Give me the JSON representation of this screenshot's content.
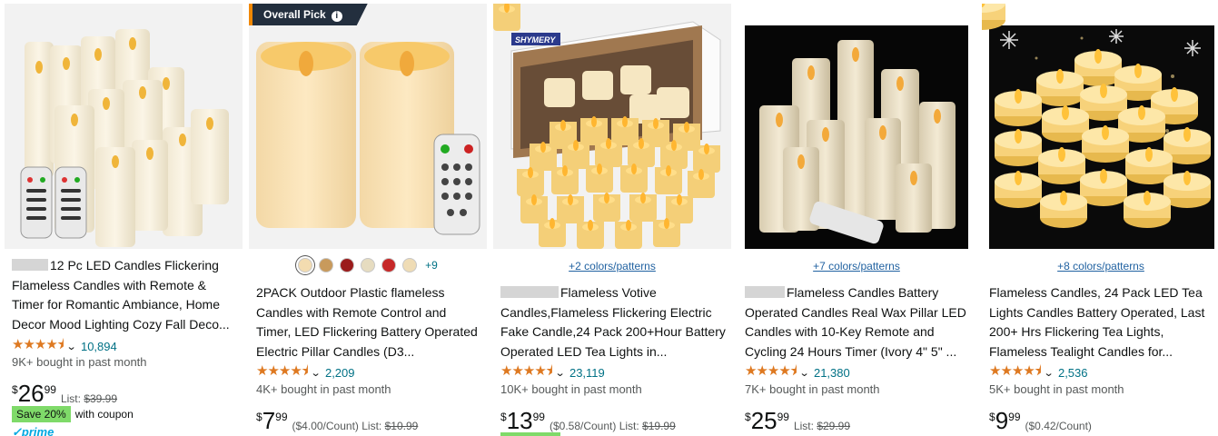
{
  "products": [
    {
      "title": "12 Pc LED Candles Flickering Flameless Candles with Remote & Timer for Romantic Ambiance, Home Decor Mood Lighting Cozy Fall Deco...",
      "stars": "★★★★⯨",
      "rating_count": "10,894",
      "bought": "9K+ bought in past month",
      "currency": "$",
      "price_whole": "26",
      "price_fraction": "99",
      "list_label": "List:",
      "list_price": "$39.99",
      "coupon_badge": "Save 20%",
      "coupon_text": "with coupon",
      "prime": "✓prime"
    },
    {
      "badge": "Overall Pick",
      "swatch_colors": [
        "#f3dcb0",
        "#c89a5c",
        "#9b1b1b",
        "#e6dcc0",
        "#c62828",
        "#efdcb5"
      ],
      "swatch_more": "+9",
      "title": "2PACK Outdoor Plastic flameless Candles with Remote Control and Timer, LED Flickering Battery Operated Electric Pillar Candles (D3...",
      "stars": "★★★★⯨",
      "rating_count": "2,209",
      "bought": "4K+ bought in past month",
      "currency": "$",
      "price_whole": "7",
      "price_fraction": "99",
      "unit_price": "($4.00/Count)",
      "list_label": "List:",
      "list_price": "$10.99"
    },
    {
      "variants": "+2 colors/patterns",
      "title": "Flameless Votive Candles,Flameless Flickering Electric Fake Candle,24 Pack 200+Hour Battery Operated LED Tea Lights in...",
      "stars": "★★★★⯨",
      "rating_count": "23,119",
      "bought": "10K+ bought in past month",
      "currency": "$",
      "price_whole": "13",
      "price_fraction": "99",
      "unit_price": "($0.58/Count)",
      "list_label": "List:",
      "list_price": "$19.99",
      "box_brand": "SHYMERY"
    },
    {
      "variants": "+7 colors/patterns",
      "title": "Flameless Candles Battery Operated Candles Real Wax Pillar LED Candles with 10-Key Remote and Cycling 24 Hours Timer (Ivory 4\" 5\" ...",
      "stars": "★★★★⯨",
      "rating_count": "21,380",
      "bought": "7K+ bought in past month",
      "currency": "$",
      "price_whole": "25",
      "price_fraction": "99",
      "list_label": "List:",
      "list_price": "$29.99"
    },
    {
      "variants": "+8 colors/patterns",
      "title": "Flameless Candles, 24 Pack LED Tea Lights Candles Battery Operated, Last 200+ Hrs Flickering Tea Lights, Flameless Tealight Candles for...",
      "stars": "★★★★⯨",
      "rating_count": "2,536",
      "bought": "5K+ bought in past month",
      "currency": "$",
      "price_whole": "9",
      "price_fraction": "99",
      "unit_price": "($0.42/Count)"
    }
  ]
}
